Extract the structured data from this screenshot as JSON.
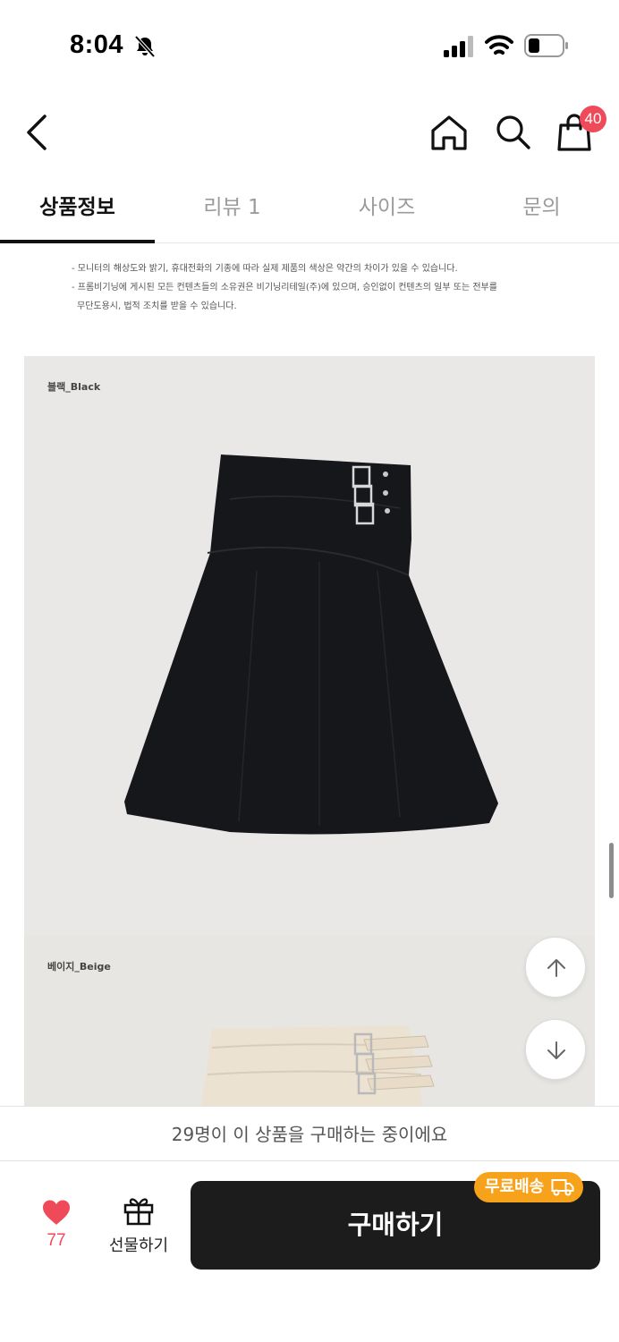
{
  "status_bar": {
    "time": "8:04"
  },
  "header": {
    "cart_count": "40"
  },
  "tabs": [
    {
      "label": "상품정보"
    },
    {
      "label": "리뷰 1"
    },
    {
      "label": "사이즈"
    },
    {
      "label": "문의"
    }
  ],
  "notice": {
    "line1": "- 모니터의 해상도와 밝기, 휴대전화의 기종에 따라 실제 제품의 색상은 약간의 차이가 있을 수 있습니다.",
    "line2": "- 프롬비기닝에 게시된 모든 컨텐츠들의 소유권은 비기닝리테일(주)에 있으며, 승인없이 컨텐츠의 일부 또는 전부를",
    "line3": "무단도용시, 법적 조치를 받을 수 있습니다."
  },
  "photos": {
    "black_label": "블랙_Black",
    "beige_label": "베이지_Beige"
  },
  "buying_message": "29명이 이 상품을 구매하는 중이에요",
  "bottom_bar": {
    "like_count": "77",
    "gift_label": "선물하기",
    "buy_label": "구매하기",
    "free_shipping_badge": "무료배송"
  },
  "colors": {
    "accent_red": "#ef4a5a",
    "buy_button": "#1c1c1c",
    "shipping_badge": "#f7a21b"
  }
}
